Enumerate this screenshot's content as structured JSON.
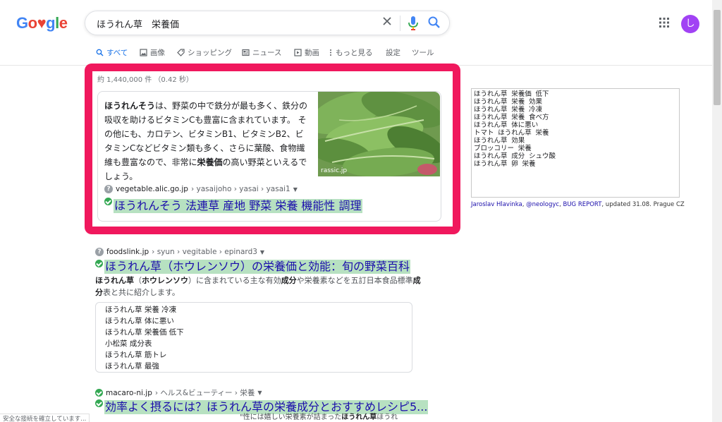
{
  "logo": {
    "letters": [
      "G",
      "o",
      "♥",
      "g",
      "l",
      "e"
    ],
    "colors": [
      "#4285f4",
      "#ea4335",
      "#ea4335",
      "#4285f4",
      "#34a853",
      "#ea4335"
    ]
  },
  "search": {
    "query": "ほうれん草　栄養価"
  },
  "account": {
    "initial": "し"
  },
  "tabs": [
    {
      "label": "すべて"
    },
    {
      "label": "画像"
    },
    {
      "label": "ショッピング"
    },
    {
      "label": "ニュース"
    },
    {
      "label": "動画"
    },
    {
      "label": "もっと見る"
    },
    {
      "label": "設定"
    },
    {
      "label": "ツール"
    }
  ],
  "results_count": "約 1,440,000 件 （0.42 秒）",
  "featured": {
    "text_bold_1": "ほうれんそう",
    "text_part_1": "は、野菜の中で鉄分が最も多く、鉄分の吸収を助けるビタミンCも豊富に含まれています。 その他にも、カロテン、ビタミンB1、ビタミンB2、ビタミンCなどビタミン類も多く、さらに葉酸、食物繊維も豊富なので、非常に",
    "text_bold_2": "栄養価",
    "text_part_2": "の高い野菜といえるでしょう。",
    "image_credit": "rassic.jp",
    "domain": "vegetable.alic.go.jp",
    "path": "› yasaijoho › yasai › yasai1",
    "title": "ほうれんそう 法連草 産地 野菜 栄養 機能性 調理"
  },
  "results": [
    {
      "domain": "foodslink.jp",
      "path": "› syun › vegitable › epinard3",
      "title": "ほうれん草（ホウレンソウ）の栄養価と効能：旬の野菜百科",
      "desc_bold_1": "ほうれん草",
      "desc_part_1": "（",
      "desc_bold_2": "ホウレンソウ",
      "desc_part_2": "）に含まれている主な有効",
      "desc_bold_3": "成分",
      "desc_part_3": "や栄養素などを五訂日本食品標準",
      "desc_bold_4": "成分",
      "desc_part_4": "表と共に紹介します。",
      "related": [
        "ほうれん草 栄養 冷凍",
        "ほうれん草 体に悪い",
        "ほうれん草 栄養価 低下",
        "小松菜 成分表",
        "ほうれん草 筋トレ",
        "ほうれん草 最強"
      ]
    },
    {
      "domain": "macaro-ni.jp",
      "path": "› ヘルス&ビューティー › 栄養",
      "title": "効率よく摂るには？ほうれん草の栄養成分とおすすめレシピ5...",
      "snippet_fragment": "\"性には嬉しい栄養素が詰まった",
      "snippet_bold": "ほうれん草",
      "snippet_tail": "ほうれ"
    }
  ],
  "status_text": "安全な接続を確立しています...",
  "side_keywords": "ほうれん草 栄養価 低下\nほうれん草 栄養 効果\nほうれん草 栄養 冷凍\nほうれん草 栄養 食べ方\nほうれん草 体に悪い\nトマト ほうれん草 栄養\nほうれん草 効果\nブロッコリー 栄養\nほうれん草 成分 シュウ酸\nほうれん草 卵 栄養",
  "side_credit": {
    "author": "Jaroslav Hlavinka",
    "sep1": ", ",
    "handle": "@neologyc",
    "sep2": ", ",
    "report": "BUG REPORT",
    "tail": ", updated 31.08. Prague CZ"
  }
}
